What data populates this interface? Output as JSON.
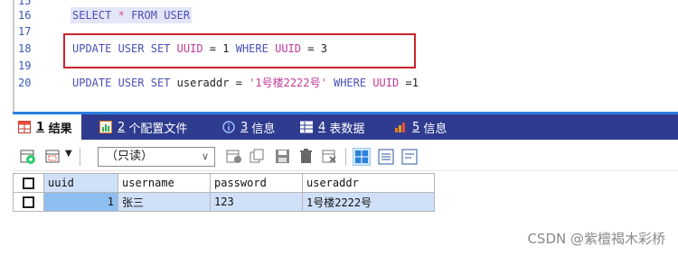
{
  "editor": {
    "lines": [
      {
        "num": "16",
        "tokens": [
          "SELECT",
          "*",
          "FROM",
          "USER"
        ]
      },
      {
        "num": "17"
      },
      {
        "num": "18",
        "tokens": [
          "UPDATE",
          "USER",
          "SET",
          "UUID",
          "=",
          "1",
          "WHERE",
          "UUID",
          "=",
          "3"
        ]
      },
      {
        "num": "19"
      },
      {
        "num": "20",
        "tokens": [
          "UPDATE",
          "USER",
          "SET",
          "useraddr",
          "=",
          "'1号楼2222号'",
          "WHERE",
          "UUID",
          "=1"
        ]
      }
    ]
  },
  "tabs": [
    {
      "num": "1",
      "label": "结果",
      "icon": "table-grid-icon"
    },
    {
      "num": "2",
      "label": "个配置文件",
      "icon": "profile-chart-icon"
    },
    {
      "num": "3",
      "label": "信息",
      "icon": "info-icon"
    },
    {
      "num": "4",
      "label": "表数据",
      "icon": "table-data-icon"
    },
    {
      "num": "5",
      "label": "信息",
      "icon": "history-info-icon"
    }
  ],
  "toolbar": {
    "mode_select_value": "（只读）"
  },
  "grid": {
    "columns": [
      "uuid",
      "username",
      "password",
      "useraddr"
    ],
    "rows": [
      [
        "1",
        "张三",
        "123",
        "1号楼2222号"
      ]
    ]
  },
  "watermark": "CSDN @紫檀褐木彩桥",
  "colors": {
    "keyword": "#4b50b4",
    "identifier": "#c0399b",
    "tab_bar": "#2f3b8f",
    "highlight_box": "#c9252b",
    "selected_row": "#cfe0f8"
  }
}
